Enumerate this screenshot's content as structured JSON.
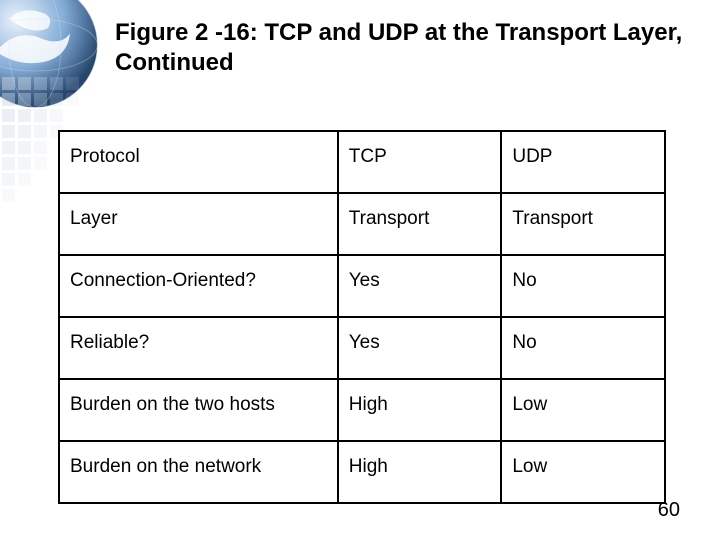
{
  "title": "Figure 2 -16: TCP and UDP at the Transport Layer, Continued",
  "page_number": "60",
  "chart_data": {
    "type": "table",
    "columns": [
      "Protocol",
      "TCP",
      "UDP"
    ],
    "rows": [
      {
        "label": "Layer",
        "tcp": "Transport",
        "udp": "Transport"
      },
      {
        "label": "Connection-Oriented?",
        "tcp": "Yes",
        "udp": "No"
      },
      {
        "label": "Reliable?",
        "tcp": "Yes",
        "udp": "No"
      },
      {
        "label": "Burden on the two hosts",
        "tcp": "High",
        "udp": "Low"
      },
      {
        "label": "Burden on the network",
        "tcp": "High",
        "udp": "Low"
      }
    ]
  }
}
